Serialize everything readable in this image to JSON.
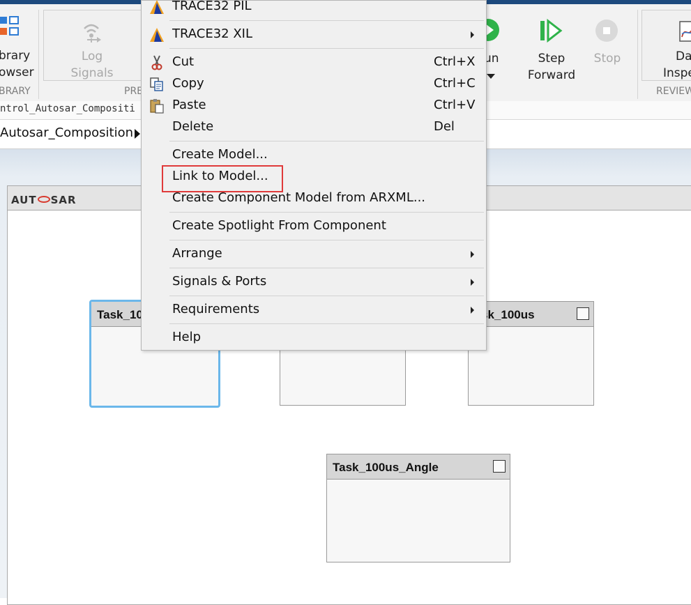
{
  "toolstrip": {
    "library_label_1": "brary",
    "library_label_2": "owser",
    "library_section": "BRARY",
    "log_label_1": "Log",
    "log_label_2": "Signals",
    "prepare_section": "PRE",
    "run_label": "un",
    "step_label_1": "Step",
    "step_label_2": "Forward",
    "stop_label": "Stop",
    "data_label_1": "Da",
    "data_label_2": "Inspe",
    "review_section": "REVIEW"
  },
  "address": {
    "path": "ntrol_Autosar_Compositi"
  },
  "breadcrumb": {
    "current": "Autosar_Composition"
  },
  "canvas": {
    "logo_text_left": "AUT",
    "logo_text_right": "SAR",
    "blocks": [
      {
        "title": "Task_10"
      },
      {
        "title": "sk_100us"
      },
      {
        "title": "Task_100us_Angle"
      }
    ]
  },
  "context_menu": {
    "items": [
      {
        "label": "TRACE32 PIL",
        "shortcut": "",
        "icon": "trace32-icon"
      },
      {
        "label": "TRACE32 XIL",
        "shortcut": "",
        "icon": "trace32-icon",
        "submenu": true
      },
      {
        "label": "Cut",
        "shortcut": "Ctrl+X",
        "icon": "scissors-icon"
      },
      {
        "label": "Copy",
        "shortcut": "Ctrl+C",
        "icon": "copy-icon"
      },
      {
        "label": "Paste",
        "shortcut": "Ctrl+V",
        "icon": "paste-icon"
      },
      {
        "label": "Delete",
        "shortcut": "Del"
      },
      {
        "label": "Create Model..."
      },
      {
        "label": "Link to Model..."
      },
      {
        "label": "Create Component Model from ARXML..."
      },
      {
        "label": "Create Spotlight From Component"
      },
      {
        "label": "Arrange",
        "submenu": true
      },
      {
        "label": "Signals & Ports",
        "submenu": true
      },
      {
        "label": "Requirements",
        "submenu": true
      },
      {
        "label": "Help"
      }
    ]
  },
  "colors": {
    "highlight_box": "#e03a3a",
    "selected_block_border": "#6bb7ea",
    "autosar_ring": "#d83a2e",
    "run_green": "#2fb34a"
  }
}
